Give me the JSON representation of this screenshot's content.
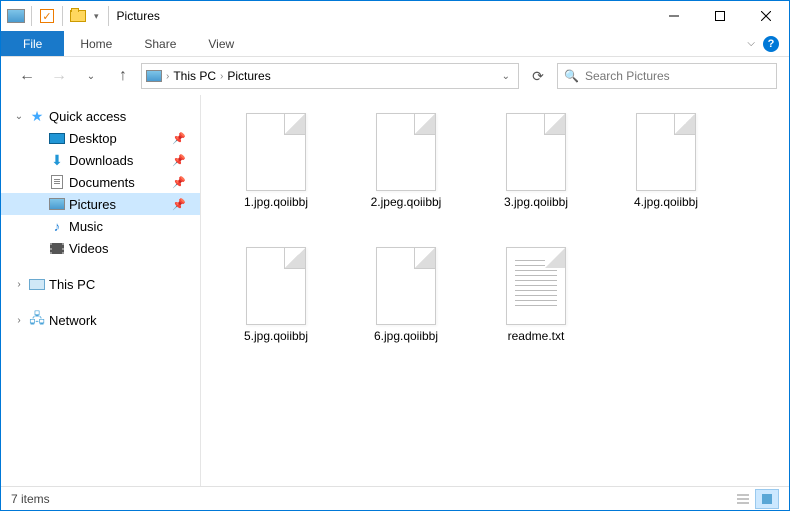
{
  "window": {
    "title": "Pictures"
  },
  "ribbon": {
    "file": "File",
    "tabs": [
      "Home",
      "Share",
      "View"
    ]
  },
  "breadcrumb": {
    "items": [
      "This PC",
      "Pictures"
    ]
  },
  "search": {
    "placeholder": "Search Pictures"
  },
  "sidebar": {
    "quickAccess": {
      "label": "Quick access",
      "expanded": true
    },
    "quickItems": [
      {
        "label": "Desktop",
        "icon": "desktop",
        "pinned": true
      },
      {
        "label": "Downloads",
        "icon": "download",
        "pinned": true
      },
      {
        "label": "Documents",
        "icon": "document",
        "pinned": true
      },
      {
        "label": "Pictures",
        "icon": "pictures",
        "pinned": true,
        "selected": true
      },
      {
        "label": "Music",
        "icon": "music",
        "pinned": false
      },
      {
        "label": "Videos",
        "icon": "video",
        "pinned": false
      }
    ],
    "thisPC": {
      "label": "This PC",
      "expanded": false
    },
    "network": {
      "label": "Network",
      "expanded": false
    }
  },
  "files": [
    {
      "name": "1.jpg.qoiibbj",
      "type": "blank"
    },
    {
      "name": "2.jpeg.qoiibbj",
      "type": "blank"
    },
    {
      "name": "3.jpg.qoiibbj",
      "type": "blank"
    },
    {
      "name": "4.jpg.qoiibbj",
      "type": "blank"
    },
    {
      "name": "5.jpg.qoiibbj",
      "type": "blank"
    },
    {
      "name": "6.jpg.qoiibbj",
      "type": "blank"
    },
    {
      "name": "readme.txt",
      "type": "text"
    }
  ],
  "status": {
    "count": "7 items"
  }
}
